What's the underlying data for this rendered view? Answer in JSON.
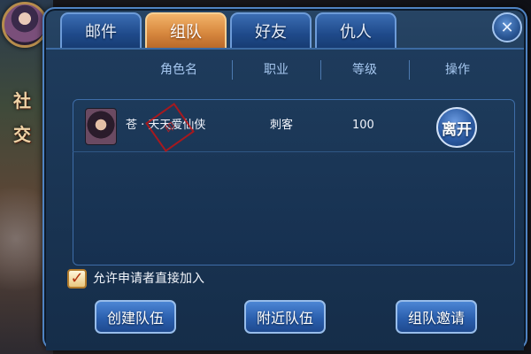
{
  "side": {
    "title_lines": [
      "社",
      "交"
    ]
  },
  "tabs": [
    {
      "label": "邮件",
      "active": false
    },
    {
      "label": "组队",
      "active": true
    },
    {
      "label": "好友",
      "active": false
    },
    {
      "label": "仇人",
      "active": false
    }
  ],
  "close_icon": "close-icon",
  "table": {
    "headers": [
      "角色名",
      "职业",
      "等级",
      "操作"
    ],
    "rows": [
      {
        "name": "苍 · 天天爱仙侠",
        "class": "刺客",
        "level": "100",
        "action_label": "离开",
        "stamp": "印"
      }
    ]
  },
  "options": {
    "allow_direct_join_label": "允许申请者直接加入",
    "allow_direct_join_checked": true
  },
  "buttons": {
    "create_team": "创建队伍",
    "nearby_team": "附近队伍",
    "team_invite": "组队邀请"
  },
  "colors": {
    "active_tab": "#d8893f",
    "panel_border": "#4f83c2",
    "header_text": "#a6c7ef"
  }
}
